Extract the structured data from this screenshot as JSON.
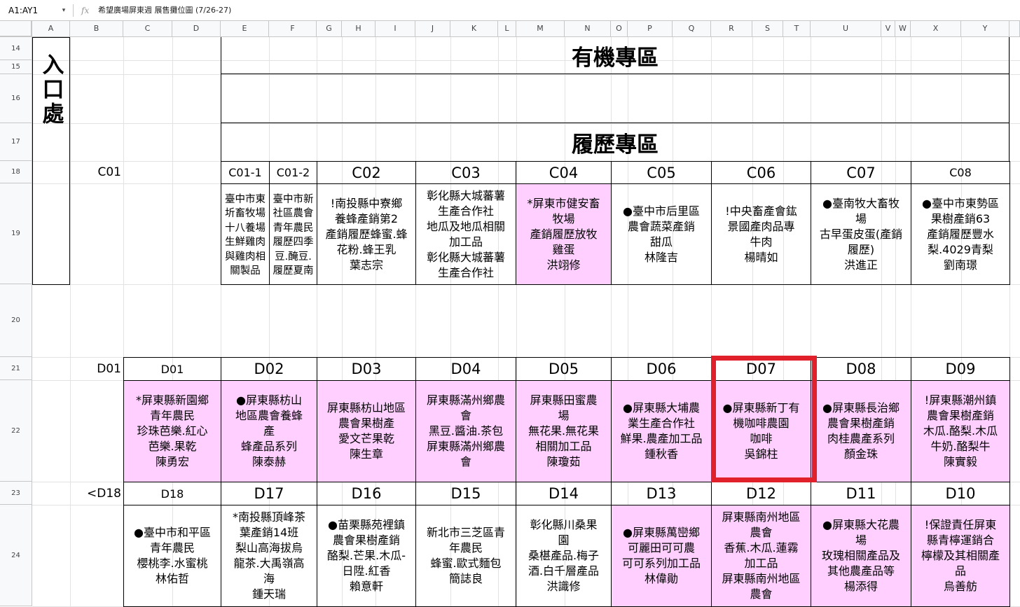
{
  "formula_bar": {
    "name_box": "A1:AY1",
    "caret": "▾",
    "fx": "fx",
    "formula": "希望廣場屏東週 展售攤位圖 (7/26-27)"
  },
  "columns": [
    "A",
    "B",
    "C",
    "D",
    "E",
    "F",
    "G",
    "H",
    "I",
    "J",
    "K",
    "L",
    "M",
    "N",
    "O",
    "P",
    "Q",
    "R",
    "S",
    "T",
    "U",
    "V",
    "W",
    "X",
    "Y"
  ],
  "rows": [
    "14",
    "15",
    "16",
    "17",
    "18",
    "19",
    "20",
    "21",
    "22",
    "23",
    "24"
  ],
  "entrance": {
    "label": "入口處"
  },
  "zones": {
    "organic": "有機專區",
    "traceability": "履歷專區"
  },
  "row_labels": {
    "c": "C01",
    "d_top": "D01",
    "d_bottom": "<D18"
  },
  "c_row": [
    {
      "code": "C01-1",
      "lines": [
        "臺中市東圻畜牧場十八養場生鮮雞肉與雞肉相關製品"
      ],
      "pink": false
    },
    {
      "code": "C01-2",
      "lines": [
        "臺中市新社區農會青年農民履歷四季豆.醃豆.履歷夏南"
      ],
      "pink": false
    },
    {
      "code": "C02",
      "lines": [
        "!南投縣中寮鄉",
        "養蜂產銷第2",
        "產銷履歷蜂蜜.蜂",
        "花粉.蜂王乳",
        "葉志宗"
      ],
      "pink": false
    },
    {
      "code": "C03",
      "lines": [
        "彰化縣大城蕃薯",
        "生產合作社",
        "地瓜及地瓜相關",
        "加工品",
        "彰化縣大城蕃薯",
        "生產合作社"
      ],
      "pink": false
    },
    {
      "code": "C04",
      "lines": [
        "*屏東市健安畜",
        "牧場",
        "產銷履歷放牧",
        "雞蛋",
        "洪翊修"
      ],
      "pink": true
    },
    {
      "code": "C05",
      "lines": [
        "●臺中市后里區",
        "農會蔬菜產銷",
        "甜瓜",
        "林隆吉"
      ],
      "pink": false
    },
    {
      "code": "C06",
      "lines": [
        "!中央畜產會鈜",
        "景國產肉品專",
        "牛肉",
        "楊晴如"
      ],
      "pink": false
    },
    {
      "code": "C07",
      "lines": [
        "●臺南牧大畜牧",
        "場",
        "古早蛋皮蛋(產銷",
        "履歷)",
        "洪進正"
      ],
      "pink": false
    },
    {
      "code": "C08",
      "lines": [
        "●臺中市東勢區",
        "果樹產銷63",
        "產銷履歷豐水",
        "梨.4029青梨",
        "劉南璟"
      ],
      "pink": false
    }
  ],
  "d_top": [
    {
      "code": "D01",
      "lines": [
        "*屏東縣新園鄉",
        "青年農民",
        "珍珠芭樂.紅心",
        "芭樂.果乾",
        "陳勇宏"
      ],
      "pink": true
    },
    {
      "code": "D02",
      "lines": [
        "●屏東縣枋山",
        "地區農會養蜂",
        "產",
        "蜂產品系列",
        "陳泰赫"
      ],
      "pink": true
    },
    {
      "code": "D03",
      "lines": [
        "屏東縣枋山地區",
        "農會果樹產",
        "愛文芒果乾",
        "陳生章"
      ],
      "pink": true
    },
    {
      "code": "D04",
      "lines": [
        "屏東縣滿州鄉農",
        "會",
        "黑豆.醬油.茶包",
        "屏東縣滿州鄉農",
        "會"
      ],
      "pink": true
    },
    {
      "code": "D05",
      "lines": [
        "屏東縣田蜜農",
        "場",
        "無花果.無花果",
        "相關加工品",
        "陳瓊茹"
      ],
      "pink": true
    },
    {
      "code": "D06",
      "lines": [
        "●屏東縣大埔農",
        "業生產合作社",
        "鮮果.農產加工品",
        "鍾秋香"
      ],
      "pink": true
    },
    {
      "code": "D07",
      "lines": [
        "●屏東縣新丁有",
        "機咖啡農園",
        "咖啡",
        "吳錦柱"
      ],
      "pink": true
    },
    {
      "code": "D08",
      "lines": [
        "●屏東縣長治鄉",
        "農會果樹產銷",
        "肉桂農產系列",
        "顏金珠"
      ],
      "pink": true
    },
    {
      "code": "D09",
      "lines": [
        "!屏東縣潮州鎮",
        "農會果樹產銷",
        "木瓜.酪梨.木瓜",
        "牛奶.酪梨牛",
        "陳實毅"
      ],
      "pink": true
    }
  ],
  "d_bottom": [
    {
      "code": "D18",
      "lines": [
        "●臺中市和平區",
        "青年農民",
        "櫻桃李.水蜜桃",
        "林佑哲"
      ],
      "pink": false
    },
    {
      "code": "D17",
      "lines": [
        "*南投縣頂峰茶",
        "葉產銷14班",
        "梨山高海拔烏",
        "龍茶.大禹嶺高",
        "海",
        "鍾天瑞"
      ],
      "pink": false
    },
    {
      "code": "D16",
      "lines": [
        "●苗栗縣苑裡鎮",
        "農會果樹產銷",
        "酪梨.芒果.木瓜-",
        "日陞.紅香",
        "賴意軒"
      ],
      "pink": false
    },
    {
      "code": "D15",
      "lines": [
        "新北市三芝區青",
        "年農民",
        "蜂蜜.歐式麵包",
        "簡誌良"
      ],
      "pink": false
    },
    {
      "code": "D14",
      "lines": [
        "彰化縣川桑果",
        "園",
        "桑椹產品.梅子",
        "酒.白千層產品",
        "洪識修"
      ],
      "pink": false
    },
    {
      "code": "D13",
      "lines": [
        "●屏東縣萬巒鄉",
        "可麗田可可農",
        "可可系列加工品",
        "林偉勛"
      ],
      "pink": true
    },
    {
      "code": "D12",
      "lines": [
        "屏東縣南州地區",
        "農會",
        "香蕉.木瓜.蓮霧",
        "加工品",
        "屏東縣南州地區",
        "農會"
      ],
      "pink": true
    },
    {
      "code": "D11",
      "lines": [
        "●屏東縣大花農",
        "場",
        "玫瑰相關產品及",
        "其他農產品等",
        "楊添得"
      ],
      "pink": true
    },
    {
      "code": "D10",
      "lines": [
        "!保證責任屏東",
        "縣青檸運銷合",
        "檸檬及其相關產",
        "品",
        "烏善舫"
      ],
      "pink": true
    }
  ]
}
